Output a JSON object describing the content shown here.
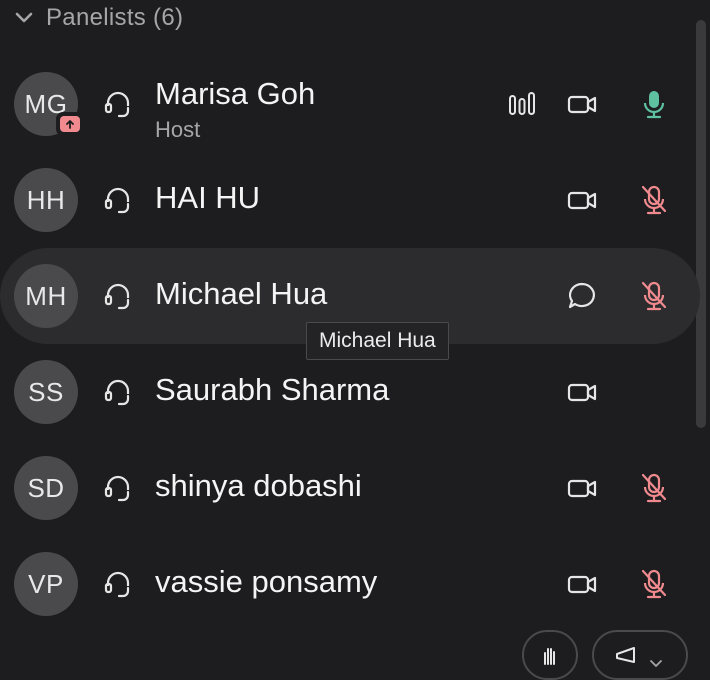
{
  "header": {
    "label": "Panelists (6)",
    "expand_icon": "chevron-down-icon"
  },
  "panelists": [
    {
      "initials": "MG",
      "name": "Marisa Goh",
      "role": "Host",
      "sharing": true,
      "audio_level": true,
      "video": true,
      "mic": "on"
    },
    {
      "initials": "HH",
      "name": "HAI HU",
      "video": true,
      "mic": "muted"
    },
    {
      "initials": "MH",
      "name": "Michael Hua",
      "chat": true,
      "mic": "muted",
      "hovered": true
    },
    {
      "initials": "SS",
      "name": "Saurabh Sharma",
      "video": true
    },
    {
      "initials": "SD",
      "name": "shinya dobashi",
      "video": true,
      "mic": "muted"
    },
    {
      "initials": "VP",
      "name": "vassie ponsamy",
      "video": true,
      "mic": "muted"
    }
  ],
  "tooltip": {
    "text": "Michael Hua"
  },
  "colors": {
    "mic_on": "#5fc0a0",
    "mic_muted": "#f08a8f",
    "share_badge": "#f08a8f",
    "icon": "#e6e6e6"
  },
  "footer": {
    "raise_hand_icon": "raise-hand-icon",
    "reactions_icon": "megaphone-icon"
  }
}
